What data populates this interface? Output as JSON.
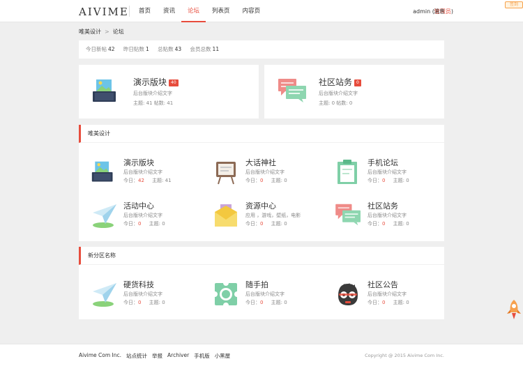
{
  "header": {
    "logo": "AIVIME",
    "nav": [
      "首页",
      "资讯",
      "论坛",
      "列表页",
      "内容页"
    ],
    "active": "论坛",
    "user": "admin",
    "role_open": "(",
    "role": "管理员",
    "role_close": ")",
    "messages": "消息",
    "sign_badge": "签到"
  },
  "breadcrumb": {
    "home": "唯美设计",
    "sep": ">",
    "current": "论坛"
  },
  "stats": {
    "today_label": "今日新帖",
    "today": "42",
    "yesterday_label": "昨日贴数",
    "yesterday": "1",
    "posts_label": "总贴数",
    "posts": "43",
    "members_label": "会员总数",
    "members": "11"
  },
  "featured": [
    {
      "title": "演示版块",
      "badge": "40",
      "desc": "后台版块介绍文字",
      "meta": "主题: 41    帖数: 41"
    },
    {
      "title": "社区站务",
      "badge": "0",
      "desc": "后台版块介绍文字",
      "meta": "主题: 0    帖数: 0"
    }
  ],
  "sections": [
    {
      "title": "唯美设计",
      "forums": [
        {
          "name": "演示版块",
          "desc": "后台版块介绍文字",
          "today_label": "今日：",
          "today": "42",
          "topics": "主题: 41"
        },
        {
          "name": "大话神社",
          "desc": "后台版块介绍文字",
          "today_label": "今日：",
          "today": "0",
          "topics": "主题: 0"
        },
        {
          "name": "手机论坛",
          "desc": "后台版块介绍文字",
          "today_label": "今日：",
          "today": "0",
          "topics": "主题: 0"
        },
        {
          "name": "活动中心",
          "desc": "后台版块介绍文字",
          "today_label": "今日：",
          "today": "0",
          "topics": "主题: 0"
        },
        {
          "name": "资源中心",
          "desc": "应用 ，游戏，壁纸，电影",
          "today_label": "今日：",
          "today": "0",
          "topics": "主题: 0"
        },
        {
          "name": "社区站务",
          "desc": "后台版块介绍文字",
          "today_label": "今日：",
          "today": "0",
          "topics": "主题: 0"
        }
      ]
    },
    {
      "title": "新分区名称",
      "forums": [
        {
          "name": "硬货科技",
          "desc": "后台版块介绍文字",
          "today_label": "今日：",
          "today": "0",
          "topics": "主题: 0"
        },
        {
          "name": "随手拍",
          "desc": "后台版块介绍文字",
          "today_label": "今日：",
          "today": "0",
          "topics": "主题: 0"
        },
        {
          "name": "社区公告",
          "desc": "后台版块介绍文字",
          "today_label": "今日：",
          "today": "0",
          "topics": "主题: 0"
        }
      ]
    }
  ],
  "footer": {
    "links": [
      "Aivime Com Inc.",
      "站点统计",
      "举报",
      "Archiver",
      "手机版",
      "小黑屋"
    ],
    "copyright": "Copyright @ 2015 Aivime Com Inc."
  },
  "colors": {
    "accent": "#e74c3c",
    "background": "#efefef"
  }
}
